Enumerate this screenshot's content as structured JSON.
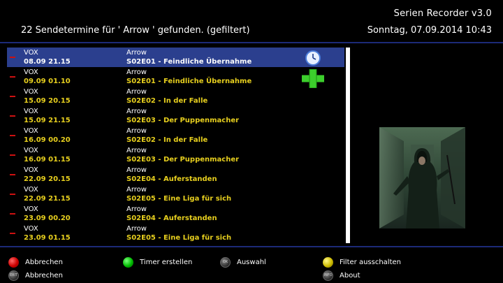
{
  "header": {
    "app_title": "Serien Recorder v3.0",
    "info": "22 Sendetermine für ' Arrow ' gefunden. (gefiltert)",
    "date_time": "Sonntag, 07.09.2014  10:43"
  },
  "rows": [
    {
      "sender": "VOX",
      "datetime": "08.09 21.15",
      "series": "Arrow",
      "episode": "S02E01 - Feindliche Übernahme",
      "selected": true
    },
    {
      "sender": "VOX",
      "datetime": "09.09 01.10",
      "series": "Arrow",
      "episode": "S02E01 - Feindliche Übernahme",
      "selected": false
    },
    {
      "sender": "VOX",
      "datetime": "15.09 20.15",
      "series": "Arrow",
      "episode": "S02E02 - In der Falle",
      "selected": false
    },
    {
      "sender": "VOX",
      "datetime": "15.09 21.15",
      "series": "Arrow",
      "episode": "S02E03 - Der Puppenmacher",
      "selected": false
    },
    {
      "sender": "VOX",
      "datetime": "16.09 00.20",
      "series": "Arrow",
      "episode": "S02E02 - In der Falle",
      "selected": false
    },
    {
      "sender": "VOX",
      "datetime": "16.09 01.15",
      "series": "Arrow",
      "episode": "S02E03 - Der Puppenmacher",
      "selected": false
    },
    {
      "sender": "VOX",
      "datetime": "22.09 20.15",
      "series": "Arrow",
      "episode": "S02E04 - Auferstanden",
      "selected": false
    },
    {
      "sender": "VOX",
      "datetime": "22.09 21.15",
      "series": "Arrow",
      "episode": "S02E05 - Eine Liga für sich",
      "selected": false
    },
    {
      "sender": "VOX",
      "datetime": "23.09 00.20",
      "series": "Arrow",
      "episode": "S02E04 - Auferstanden",
      "selected": false
    },
    {
      "sender": "VOX",
      "datetime": "23.09 01.15",
      "series": "Arrow",
      "episode": "S02E05 - Eine Liga für sich",
      "selected": false
    }
  ],
  "footer": {
    "red_label": "Abbrechen",
    "green_label": "Timer erstellen",
    "ok_label": "Auswahl",
    "yellow_label": "Filter ausschalten",
    "exit_label": "Abbrechen",
    "info_label": "About",
    "ok_icon_text": "OK",
    "exit_icon_text": "EXIT",
    "info_icon_text": "INFO"
  },
  "colors": {
    "accent_yellow": "#e7cf1e",
    "selection": "#2b3f8e",
    "separator": "#1c2a78",
    "marker_red": "#cc1111"
  },
  "icons": {
    "timer_clock": "clock-icon",
    "add_timer": "plus-icon"
  }
}
